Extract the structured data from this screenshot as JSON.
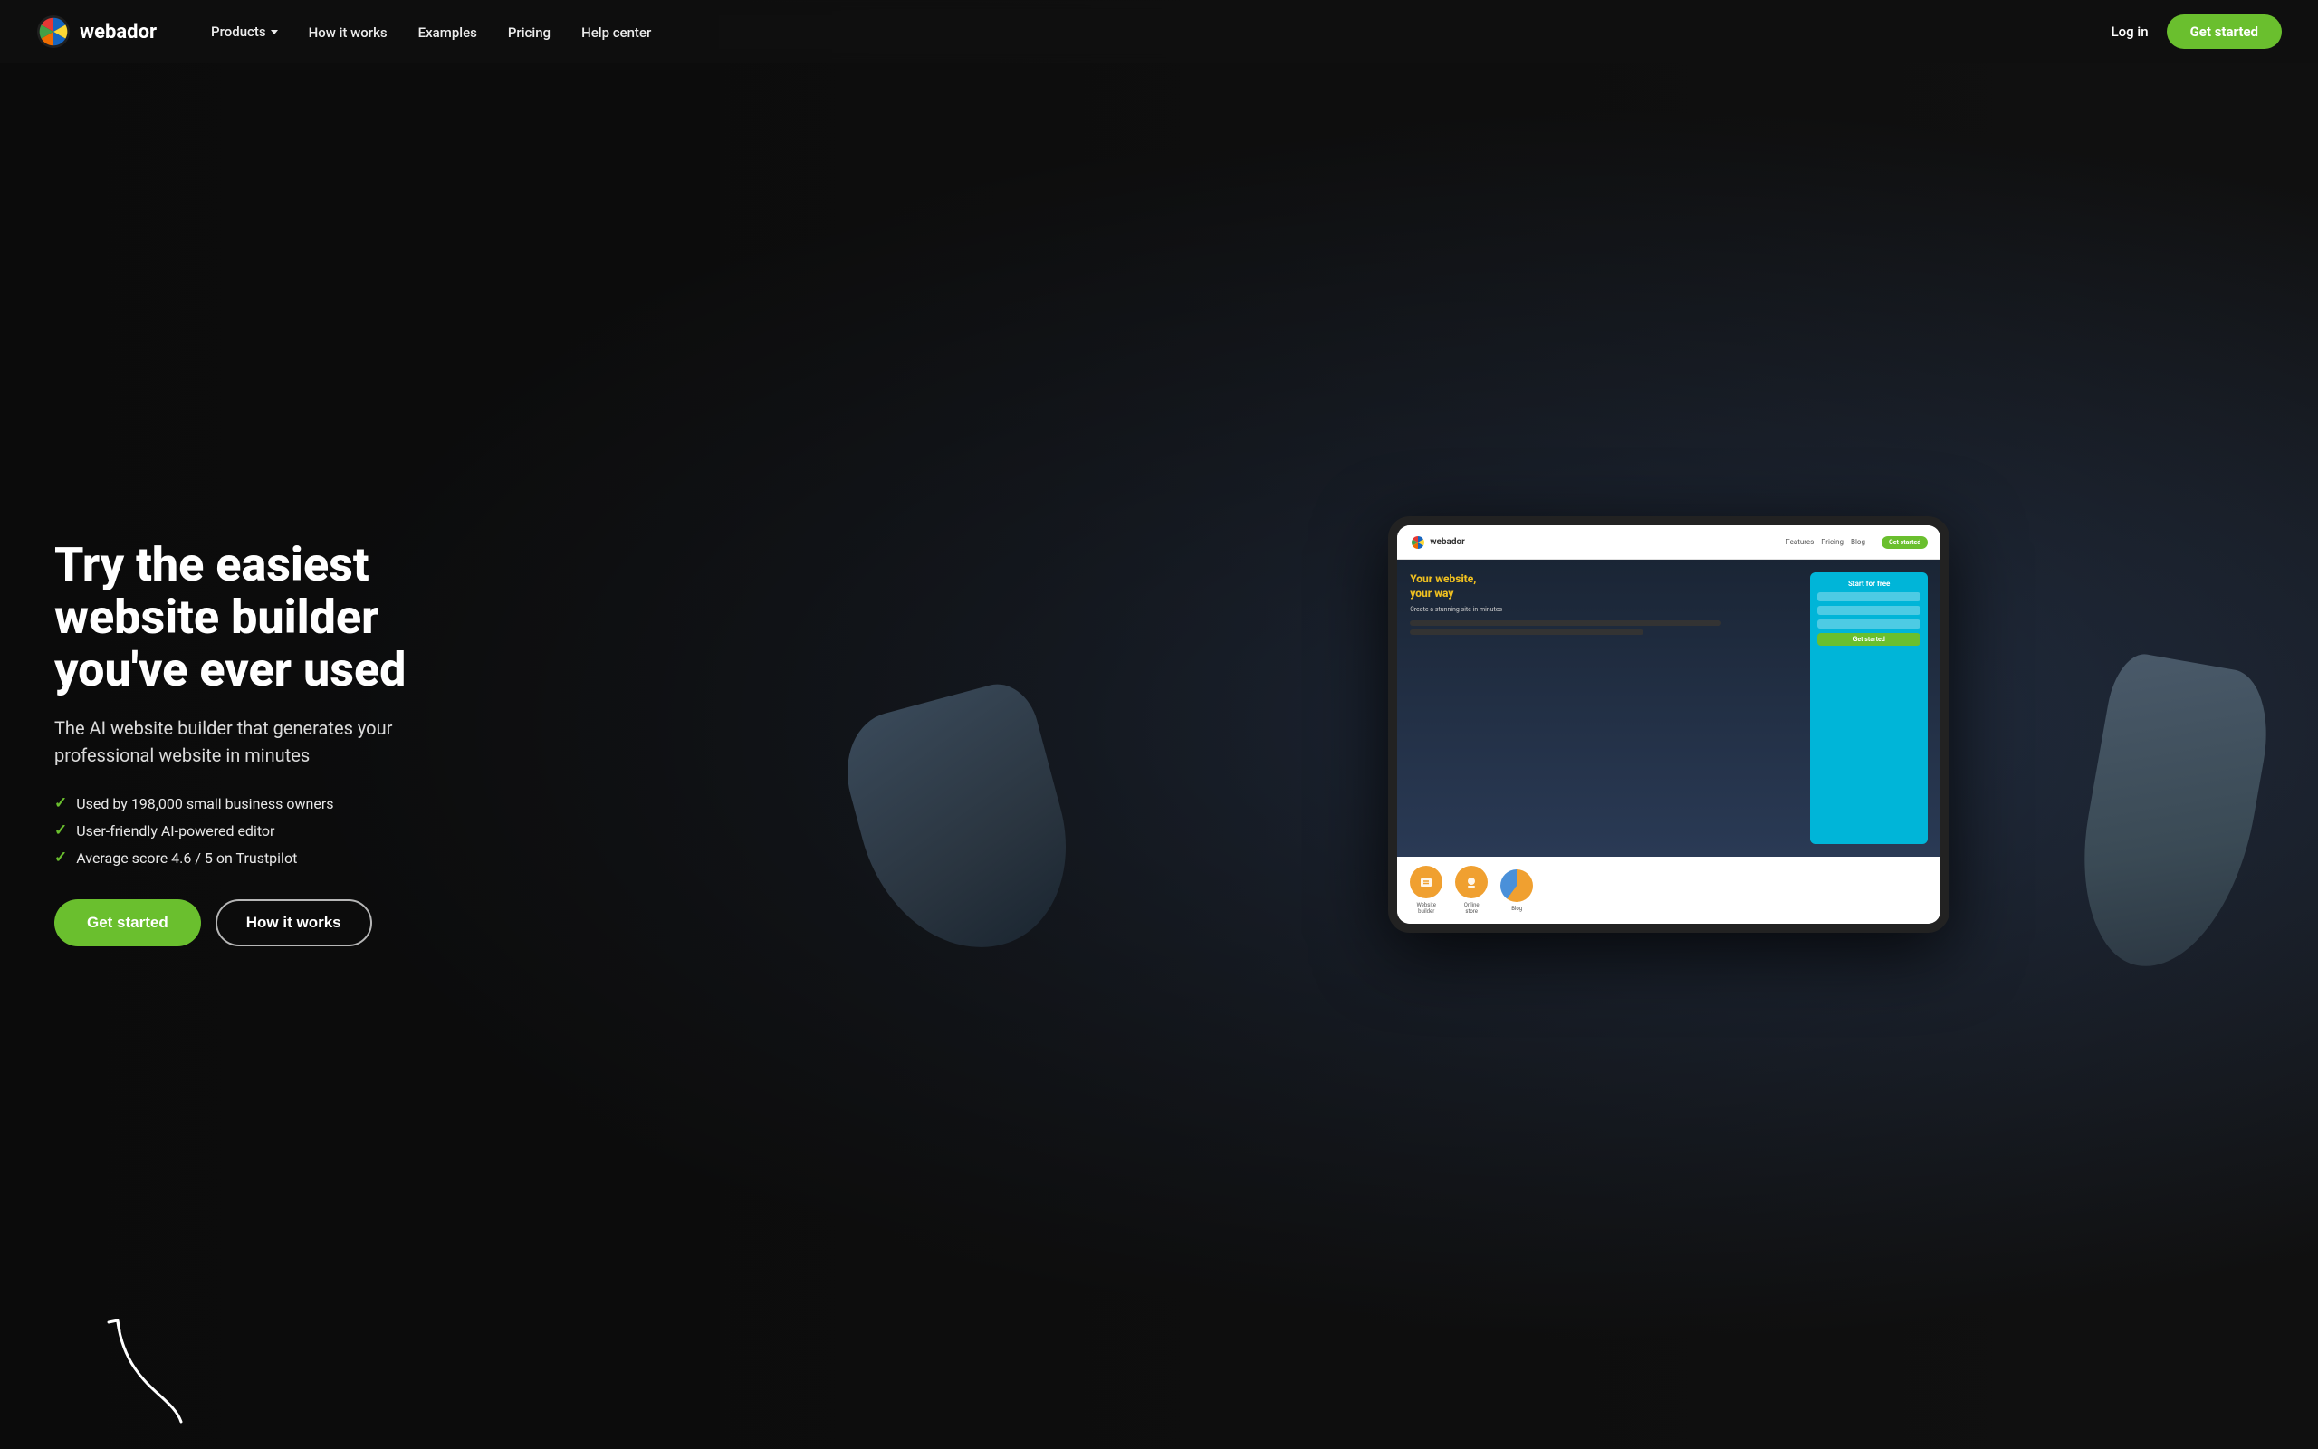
{
  "brand": {
    "name": "webador",
    "logo_icon": "webador-logo"
  },
  "navbar": {
    "products_label": "Products",
    "how_it_works_label": "How it works",
    "examples_label": "Examples",
    "pricing_label": "Pricing",
    "help_center_label": "Help center",
    "login_label": "Log in",
    "get_started_label": "Get started"
  },
  "hero": {
    "title": "Try the easiest website builder you've ever used",
    "subtitle": "The AI website builder that generates your professional website in minutes",
    "checks": [
      "Used by 198,000 small business owners",
      "User-friendly AI-powered editor",
      "Average score 4.6 / 5 on Trustpilot"
    ],
    "get_started_label": "Get started",
    "how_it_works_label": "How it works"
  },
  "tablet": {
    "logo_text": "webador",
    "nav_links": [
      "Features",
      "Pricing",
      "Blog"
    ],
    "cta_btn_text": "Get started",
    "hero_title": "Your website, your way",
    "bottom_icons": [
      {
        "label": "Website builder",
        "color": "#f0a030"
      },
      {
        "label": "Online store",
        "color": "#f0a030"
      },
      {
        "label": "Blog",
        "color": "#4a90d9"
      }
    ]
  }
}
